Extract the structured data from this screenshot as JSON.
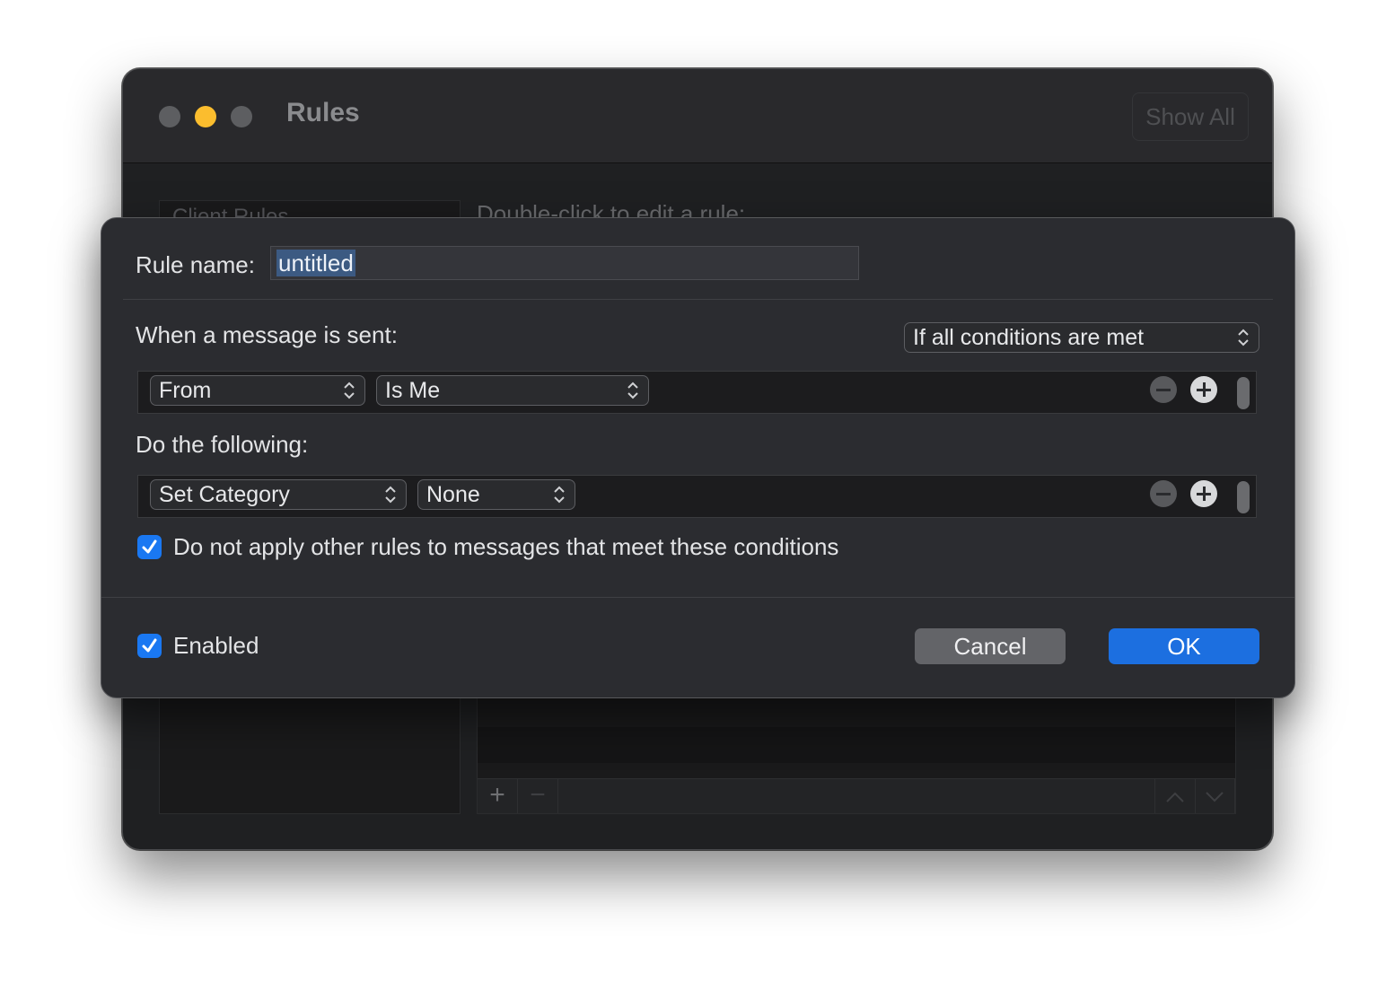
{
  "window": {
    "title": "Rules",
    "show_all_label": "Show All",
    "left_list_header": "Client Rules",
    "right_header": "Double-click to edit a rule:",
    "add_symbol": "+",
    "remove_symbol": "−"
  },
  "sheet": {
    "rule_name_label": "Rule name:",
    "rule_name_value": "untitled",
    "when_label": "When a message is sent:",
    "match_mode": "If all conditions are met",
    "condition": {
      "field": "From",
      "operator": "Is Me"
    },
    "actions_label": "Do the following:",
    "action": {
      "type": "Set Category",
      "value": "None"
    },
    "stop_rules_label": "Do not apply other rules to messages that meet these conditions",
    "stop_rules_checked": true,
    "enabled_label": "Enabled",
    "enabled_checked": true,
    "cancel_label": "Cancel",
    "ok_label": "OK"
  },
  "colors": {
    "accent": "#1c6fe0",
    "checkbox": "#1a78f2",
    "minimize_light": "#fbbd2e"
  }
}
